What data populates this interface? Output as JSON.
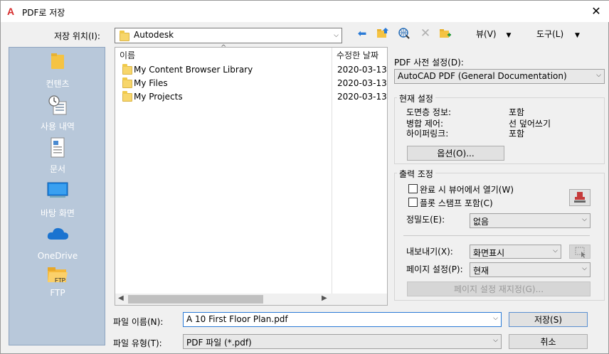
{
  "window": {
    "title": "PDF로 저장",
    "app_icon": "A"
  },
  "location": {
    "label": "저장 위치(I):",
    "value": "Autodesk"
  },
  "toolbar": {
    "view_label": "뷰(V)",
    "tools_label": "도구(L)"
  },
  "sidebar": {
    "items": [
      {
        "label": "컨텐츠",
        "icon": "folder-icon"
      },
      {
        "label": "사용 내역",
        "icon": "history-icon"
      },
      {
        "label": "문서",
        "icon": "document-icon"
      },
      {
        "label": "바탕 화면",
        "icon": "desktop-icon"
      },
      {
        "label": "OneDrive",
        "icon": "cloud-icon"
      },
      {
        "label": "FTP",
        "icon": "ftp-folder-icon"
      }
    ],
    "ftp_badge": "FTP"
  },
  "filelist": {
    "col_name": "이름",
    "col_date": "수정한 날짜",
    "rows": [
      {
        "name": "My Content Browser Library",
        "date": "2020-03-13"
      },
      {
        "name": "My Files",
        "date": "2020-03-13"
      },
      {
        "name": "My Projects",
        "date": "2020-03-13"
      }
    ]
  },
  "filename": {
    "label": "파일 이름(N):",
    "value": "A 10 First Floor Plan.pdf"
  },
  "filetype": {
    "label": "파일 유형(T):",
    "value": "PDF 파일 (*.pdf)"
  },
  "buttons": {
    "save": "저장(S)",
    "cancel": "취소"
  },
  "pdf_preset": {
    "label": "PDF 사전 설정(D):",
    "value": "AutoCAD PDF (General Documentation)"
  },
  "current_settings": {
    "title": "현재 설정",
    "rows": [
      {
        "key": "도면층 정보:",
        "value": "포함"
      },
      {
        "key": "병합 제어:",
        "value": "선 덮어쓰기"
      },
      {
        "key": "하이퍼링크:",
        "value": "포함"
      }
    ],
    "options_button": "옵션(O)..."
  },
  "output": {
    "title": "출력 조정",
    "open_viewer": "완료 시 뷰어에서 열기(W)",
    "plot_stamp": "플롯 스탬프 포함(C)",
    "quality_label": "정밀도(E):",
    "quality_value": "없음",
    "export_label": "내보내기(X):",
    "export_value": "화면표시",
    "page_setup_label": "페이지 설정(P):",
    "page_setup_value": "현재",
    "page_setup_override": "페이지 설정 재지정(G)..."
  }
}
